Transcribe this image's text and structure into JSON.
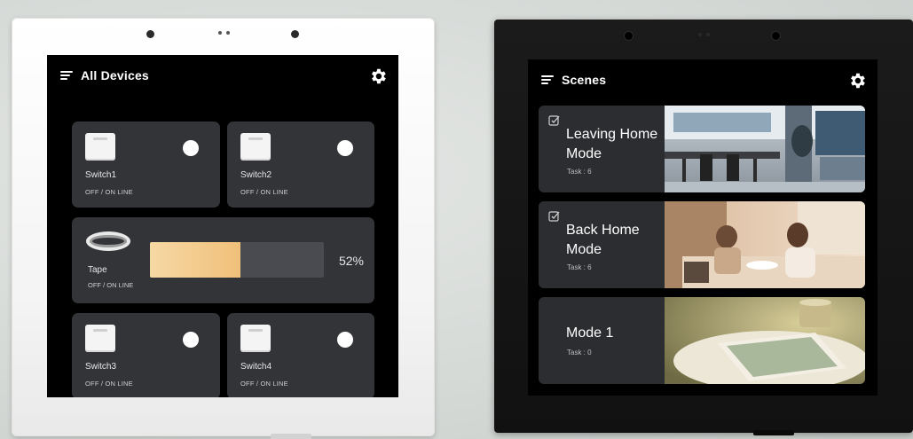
{
  "left_panel": {
    "header": {
      "title": "All Devices"
    },
    "devices": [
      {
        "name": "Switch1",
        "status": "OFF / ON LINE"
      },
      {
        "name": "Switch2",
        "status": "OFF / ON LINE"
      },
      {
        "name": "Switch3",
        "status": "OFF / ON LINE"
      },
      {
        "name": "Switch4",
        "status": "OFF / ON LINE"
      }
    ],
    "tape": {
      "name": "Tape",
      "status": "OFF / ON LINE",
      "level_label": "52%",
      "level": 0.52
    }
  },
  "right_panel": {
    "header": {
      "title": "Scenes"
    },
    "scenes": [
      {
        "name": "Leaving Home Mode",
        "task": "Task : 6",
        "photo": "living-room-photo"
      },
      {
        "name": "Back Home Mode",
        "task": "Task : 6",
        "photo": "family-dining-photo"
      },
      {
        "name": "Mode 1",
        "task": "Task : 0",
        "photo": "book-and-cup-photo"
      }
    ]
  },
  "colors": {
    "screen_bg": "#000000",
    "tile_bg": "#333438",
    "accent_fill": "#f0c07a",
    "white_panel": "#f3f3f3",
    "black_panel": "#151515"
  }
}
